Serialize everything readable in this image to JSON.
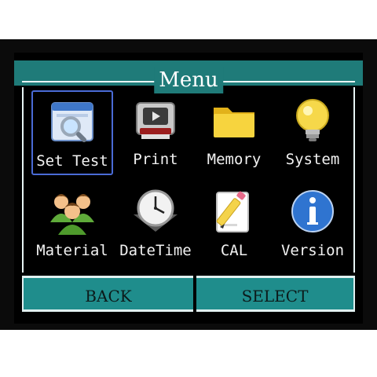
{
  "header": {
    "title": "Menu"
  },
  "menu": {
    "items": [
      {
        "label": "Set Test",
        "icon": "magnifier-window-icon"
      },
      {
        "label": "Print",
        "icon": "printer-icon"
      },
      {
        "label": "Memory",
        "icon": "folder-icon"
      },
      {
        "label": "System",
        "icon": "lightbulb-icon"
      },
      {
        "label": "Material",
        "icon": "people-group-icon"
      },
      {
        "label": "DateTime",
        "icon": "clock-icon"
      },
      {
        "label": "CAL",
        "icon": "pencil-document-icon"
      },
      {
        "label": "Version",
        "icon": "info-icon"
      }
    ],
    "selected_label": "Set Test"
  },
  "buttons": {
    "back": "BACK",
    "select": "SELECT"
  },
  "colors": {
    "accent": "#1f7b79",
    "button": "#1f8d8c",
    "selection": "#4a6bd6",
    "screen_bg": "#000000"
  }
}
